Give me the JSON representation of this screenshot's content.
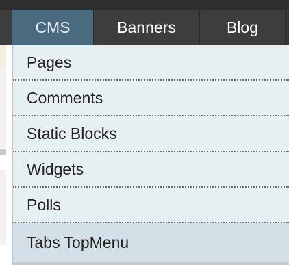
{
  "nav": {
    "items": [
      {
        "label": "CMS",
        "active": true
      },
      {
        "label": "Banners",
        "active": false
      },
      {
        "label": "Blog",
        "active": false
      }
    ]
  },
  "dropdown": {
    "items": [
      {
        "label": "Pages"
      },
      {
        "label": "Comments"
      },
      {
        "label": "Static Blocks"
      },
      {
        "label": "Widgets"
      },
      {
        "label": "Polls"
      },
      {
        "label": "Tabs TopMenu",
        "highlighted": true
      }
    ]
  },
  "colors": {
    "navbar_bg": "#3d3d3d",
    "active_tab_bg": "#4a6a80",
    "dropdown_bg": "#e6eff2",
    "highlight_bg": "#d4e0e7",
    "text": "#222222"
  }
}
